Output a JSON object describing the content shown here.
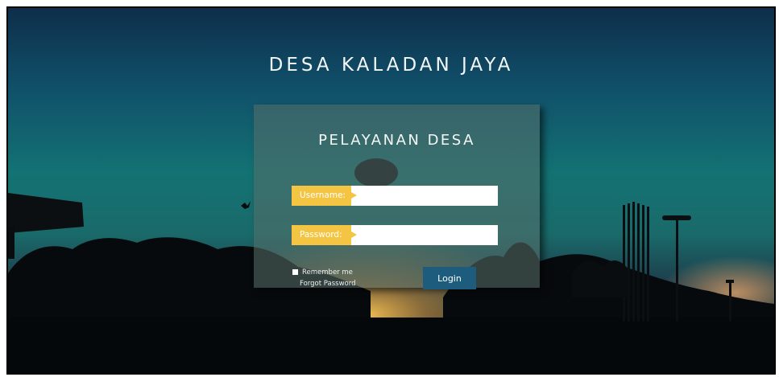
{
  "site": {
    "title": "DESA KALADAN JAYA"
  },
  "login": {
    "title": "PELAYANAN DESA",
    "username_label": "Username:",
    "password_label": "Password:",
    "username_value": "",
    "password_value": "",
    "remember_label": "Remember me",
    "forgot_label": "Forgot Password",
    "login_label": "Login"
  },
  "colors": {
    "label_bg": "#f4c542",
    "button_bg": "#1d5c7d",
    "panel_bg": "rgba(88,112,106,0.55)"
  },
  "icons": {
    "checkbox": "checkbox-icon",
    "pointer": "arrow-right-icon"
  }
}
